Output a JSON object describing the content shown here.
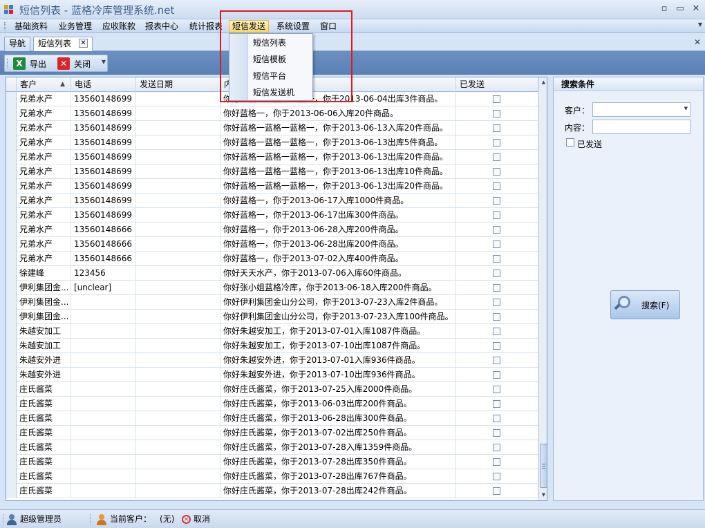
{
  "window": {
    "title": "短信列表 - 蓝格冷库管理系统.net",
    "controls": {
      "minimize": "▫",
      "restore": "▭",
      "close": "✕"
    }
  },
  "menubar": {
    "items": [
      "基础资料",
      "业务管理",
      "应收账款",
      "报表中心",
      "统计报表",
      "短信发送",
      "系统设置",
      "窗口"
    ],
    "active": "短信发送"
  },
  "dropdown": {
    "items": [
      "短信列表",
      "短信模板",
      "短信平台",
      "短信发送机"
    ]
  },
  "tabs": {
    "nav_label": "导航",
    "current_label": "短信列表",
    "close_glyph": "✕"
  },
  "toolbar": {
    "export_label": "导出",
    "close_label": "关闭",
    "export_icon": "excel-icon",
    "close_icon": "close-icon"
  },
  "grid": {
    "columns": [
      "客户",
      "电话",
      "发送日期",
      "内容",
      "已发送"
    ],
    "sort_column": "客户",
    "sort_direction": "ascending",
    "rows": [
      {
        "customer": "兄弟水产",
        "phone": "13560148699",
        "date": "",
        "content": "你好蓝格一蓝格一蓝格一，你于2013-06-04出库3件商品。",
        "sent": false
      },
      {
        "customer": "兄弟水产",
        "phone": "13560148699",
        "date": "",
        "content": "你好蓝格一，你于2013-06-06入库20件商品。",
        "sent": false
      },
      {
        "customer": "兄弟水产",
        "phone": "13560148699",
        "date": "",
        "content": "你好蓝格一蓝格一蓝格一，你于2013-06-13入库20件商品。",
        "sent": false
      },
      {
        "customer": "兄弟水产",
        "phone": "13560148699",
        "date": "",
        "content": "你好蓝格一蓝格一蓝格一，你于2013-06-13出库5件商品。",
        "sent": false
      },
      {
        "customer": "兄弟水产",
        "phone": "13560148699",
        "date": "",
        "content": "你好蓝格一蓝格一蓝格一，你于2013-06-13出库20件商品。",
        "sent": false
      },
      {
        "customer": "兄弟水产",
        "phone": "13560148699",
        "date": "",
        "content": "你好蓝格一蓝格一蓝格一，你于2013-06-13出库10件商品。",
        "sent": false
      },
      {
        "customer": "兄弟水产",
        "phone": "13560148699",
        "date": "",
        "content": "你好蓝格一蓝格一蓝格一，你于2013-06-13出库20件商品。",
        "sent": false
      },
      {
        "customer": "兄弟水产",
        "phone": "13560148699",
        "date": "",
        "content": "你好蓝格一，你于2013-06-17入库1000件商品。",
        "sent": false
      },
      {
        "customer": "兄弟水产",
        "phone": "13560148699",
        "date": "",
        "content": "你好蓝格一，你于2013-06-17出库300件商品。",
        "sent": false
      },
      {
        "customer": "兄弟水产",
        "phone": "13560148666",
        "date": "",
        "content": "你好蓝格一，你于2013-06-28入库200件商品。",
        "sent": false
      },
      {
        "customer": "兄弟水产",
        "phone": "13560148666",
        "date": "",
        "content": "你好蓝格一，你于2013-06-28出库200件商品。",
        "sent": false
      },
      {
        "customer": "兄弟水产",
        "phone": "13560148666",
        "date": "",
        "content": "你好蓝格一，你于2013-07-02入库400件商品。",
        "sent": false
      },
      {
        "customer": "徐建峰",
        "phone": "123456",
        "date": "",
        "content": "你好天天水产，你于2013-07-06入库60件商品。",
        "sent": false
      },
      {
        "customer": "伊利集团金...",
        "phone": "[unclear]",
        "date": "",
        "content": "你好张小姐蓝格冷库，你于2013-06-18入库200件商品。",
        "sent": false
      },
      {
        "customer": "伊利集团金...",
        "phone": "",
        "date": "",
        "content": "你好伊利集团金山分公司，你于2013-07-23入库2件商品。",
        "sent": false
      },
      {
        "customer": "伊利集团金...",
        "phone": "",
        "date": "",
        "content": "你好伊利集团金山分公司，你于2013-07-23入库100件商品。",
        "sent": false
      },
      {
        "customer": "朱越安加工",
        "phone": "",
        "date": "",
        "content": "你好朱越安加工，你于2013-07-01入库1087件商品。",
        "sent": false
      },
      {
        "customer": "朱越安加工",
        "phone": "",
        "date": "",
        "content": "你好朱越安加工，你于2013-07-10出库1087件商品。",
        "sent": false
      },
      {
        "customer": "朱越安外进",
        "phone": "",
        "date": "",
        "content": "你好朱越安外进，你于2013-07-01入库936件商品。",
        "sent": false
      },
      {
        "customer": "朱越安外进",
        "phone": "",
        "date": "",
        "content": "你好朱越安外进，你于2013-07-10出库936件商品。",
        "sent": false
      },
      {
        "customer": "庄氏酱菜",
        "phone": "",
        "date": "",
        "content": "你好庄氏酱菜，你于2013-07-25入库2000件商品。",
        "sent": false
      },
      {
        "customer": "庄氏酱菜",
        "phone": "",
        "date": "",
        "content": "你好庄氏酱菜，你于2013-06-03出库200件商品。",
        "sent": false
      },
      {
        "customer": "庄氏酱菜",
        "phone": "",
        "date": "",
        "content": "你好庄氏酱菜，你于2013-06-28出库300件商品。",
        "sent": false
      },
      {
        "customer": "庄氏酱菜",
        "phone": "",
        "date": "",
        "content": "你好庄氏酱菜，你于2013-07-02出库250件商品。",
        "sent": false
      },
      {
        "customer": "庄氏酱菜",
        "phone": "",
        "date": "",
        "content": "你好庄氏酱菜，你于2013-07-28入库1359件商品。",
        "sent": false
      },
      {
        "customer": "庄氏酱菜",
        "phone": "",
        "date": "",
        "content": "你好庄氏酱菜，你于2013-07-28出库350件商品。",
        "sent": false
      },
      {
        "customer": "庄氏酱菜",
        "phone": "",
        "date": "",
        "content": "你好庄氏酱菜，你于2013-07-28出库767件商品。",
        "sent": false
      },
      {
        "customer": "庄氏酱菜",
        "phone": "",
        "date": "",
        "content": "你好庄氏酱菜，你于2013-07-28出库242件商品。",
        "sent": false
      }
    ]
  },
  "search_panel": {
    "title": "搜索条件",
    "customer_label": "客户：",
    "customer_value": "",
    "content_label": "内容：",
    "content_value": "",
    "sent_label": "已发送",
    "sent_checked": false,
    "search_button": "搜索(F)"
  },
  "statusbar": {
    "user": "超级管理员",
    "current_customer_label": "当前客户：",
    "current_customer_value": "(无)",
    "cancel_label": "取消"
  },
  "colors": {
    "toolbar_blue": "#5a81b6",
    "menu_active": "#f7d870",
    "annotation_red": "#e0191e",
    "excel_green": "#1e8a3a",
    "close_red": "#d9262a"
  }
}
